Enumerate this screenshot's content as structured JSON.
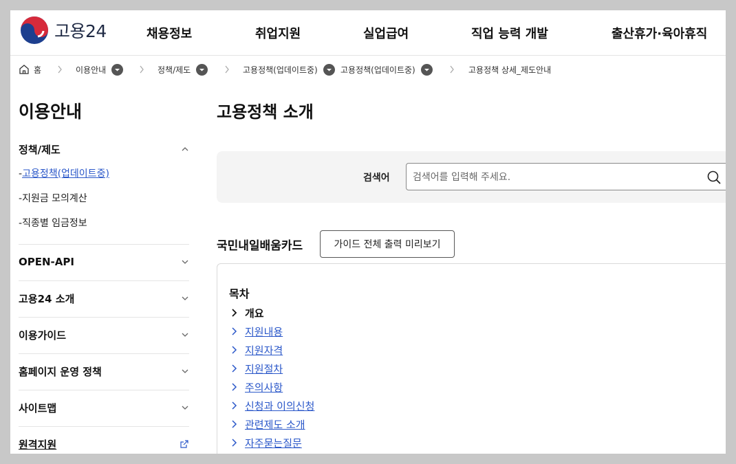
{
  "header": {
    "logo_text": "고용24",
    "nav": [
      "채용정보",
      "취업지원",
      "실업급여",
      "직업 능력 개발",
      "출산휴가·육아휴직"
    ]
  },
  "breadcrumb": {
    "home": "홈",
    "items": [
      "이용안내",
      "정책/제도",
      "고용정책(업데이트중)",
      "고용정책(업데이트중)",
      "고용정책 상세_제도안내"
    ]
  },
  "sidebar": {
    "title": "이용안내",
    "sections": [
      {
        "label": "정책/제도",
        "expanded": true,
        "children": [
          "고용정책(업데이트중)",
          "지원금 모의계산",
          "직종별 임금정보"
        ]
      },
      {
        "label": "OPEN-API"
      },
      {
        "label": "고용24 소개"
      },
      {
        "label": "이용가이드"
      },
      {
        "label": "홈페이지 운영 정책"
      },
      {
        "label": "사이트맵"
      },
      {
        "label": "원격지원"
      }
    ]
  },
  "main": {
    "title": "고용정책 소개",
    "search": {
      "label": "검색어",
      "placeholder": "검색어를 입력해 주세요."
    },
    "card_title": "국민내일배움카드",
    "guide_button": "가이드 전체 출력 미리보기",
    "toc": {
      "title": "목차",
      "items": [
        "개요",
        "지원내용",
        "지원자격",
        "지원절차",
        "주의사항",
        "신청과 이의신청",
        "관련제도 소개",
        "자주묻는질문"
      ]
    }
  },
  "colors": {
    "link": "#2a57c9",
    "logo_red": "#d62a3b",
    "logo_blue": "#1d3f8f"
  }
}
